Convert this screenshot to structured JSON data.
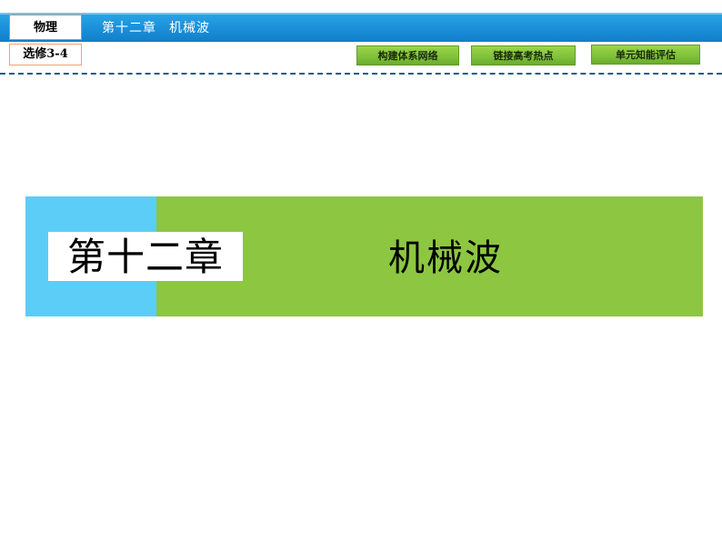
{
  "header": {
    "subject": "物理",
    "module": "选修3-4",
    "chapter": "第十二章",
    "chapter_title": "机械波"
  },
  "nav": {
    "build_network": "构建体系网络",
    "exam_hotspots": "链接高考热点",
    "unit_assessment": "单元知能评估"
  },
  "banner": {
    "chapter": "第十二章",
    "title": "机械波"
  },
  "colors": {
    "header_blue": "#1b8fd8",
    "banner_blue": "#5bcdf7",
    "banner_green": "#8dc641",
    "button_green": "#7ec13a"
  }
}
